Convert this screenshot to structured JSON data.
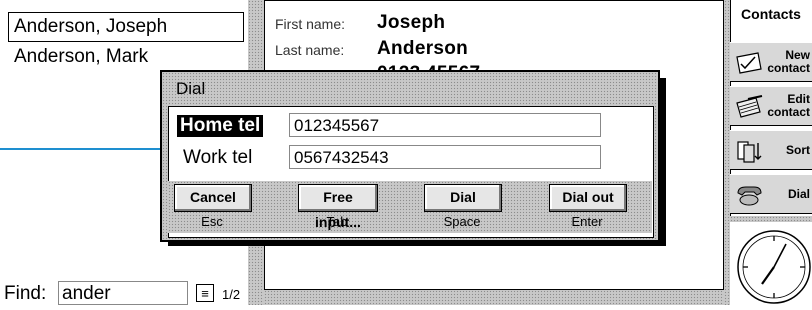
{
  "contacts_list": {
    "items": [
      "Anderson, Joseph",
      "Anderson, Mark"
    ],
    "find_label": "Find:",
    "find_value": "ander",
    "page_count": "1/2"
  },
  "details": {
    "first_name_label": "First name:",
    "first_name": "Joseph",
    "last_name_label": "Last name:",
    "last_name": "Anderson",
    "partial_value": "0123 45567"
  },
  "dialog": {
    "title": "Dial",
    "home_label": "Home tel",
    "home_value": "012345567",
    "work_label": "Work tel",
    "work_value": "0567432543",
    "buttons": [
      {
        "label": "Cancel",
        "key": "Esc"
      },
      {
        "label": "Free input...",
        "key": "Tab"
      },
      {
        "label": "Dial",
        "key": "Space"
      },
      {
        "label": "Dial out",
        "key": "Enter"
      }
    ]
  },
  "command_bar": {
    "title": "Contacts",
    "new_contact": "New\ncontact",
    "edit_contact": "Edit\ncontact",
    "sort": "Sort",
    "dial": "Dial"
  },
  "colors": {
    "pointer_line": "#1e8fd0",
    "dither": "#c8c8c8"
  }
}
